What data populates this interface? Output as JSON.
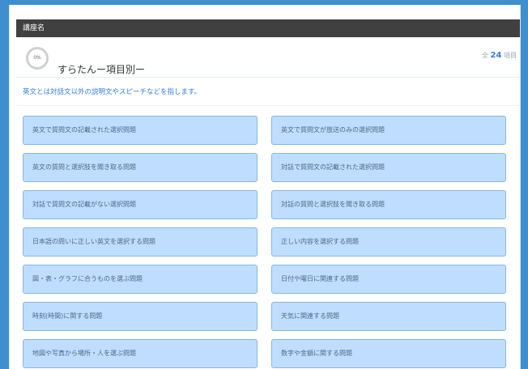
{
  "header": {
    "title": "講座名"
  },
  "course": {
    "progress_label": "0%",
    "title": "すらたんー項目別ー",
    "count_prefix": "全",
    "count": "24",
    "count_suffix": "項目"
  },
  "description": "英文とは対話文以外の説明文やスピーチなどを指します。",
  "items": [
    "英文で質問文の記載された選択問題",
    "英文で質問文が放送のみの選択問題",
    "英文の質問と選択肢を聞き取る問題",
    "対話で質問文の記載された選択問題",
    "対話で質問文の記載がない選択問題",
    "対話の質問と選択肢を聞き取る問題",
    "日本語の問いに正しい英文を選択する問題",
    "正しい内容を選択する問題",
    "図・表・グラフに合うものを選ぶ問題",
    "日付や曜日に関連する問題",
    "時刻(時間)に関する問題",
    "天気に関連する問題",
    "地図や写真から場所・人を選ぶ問題",
    "数字や金額に関する問題"
  ]
}
